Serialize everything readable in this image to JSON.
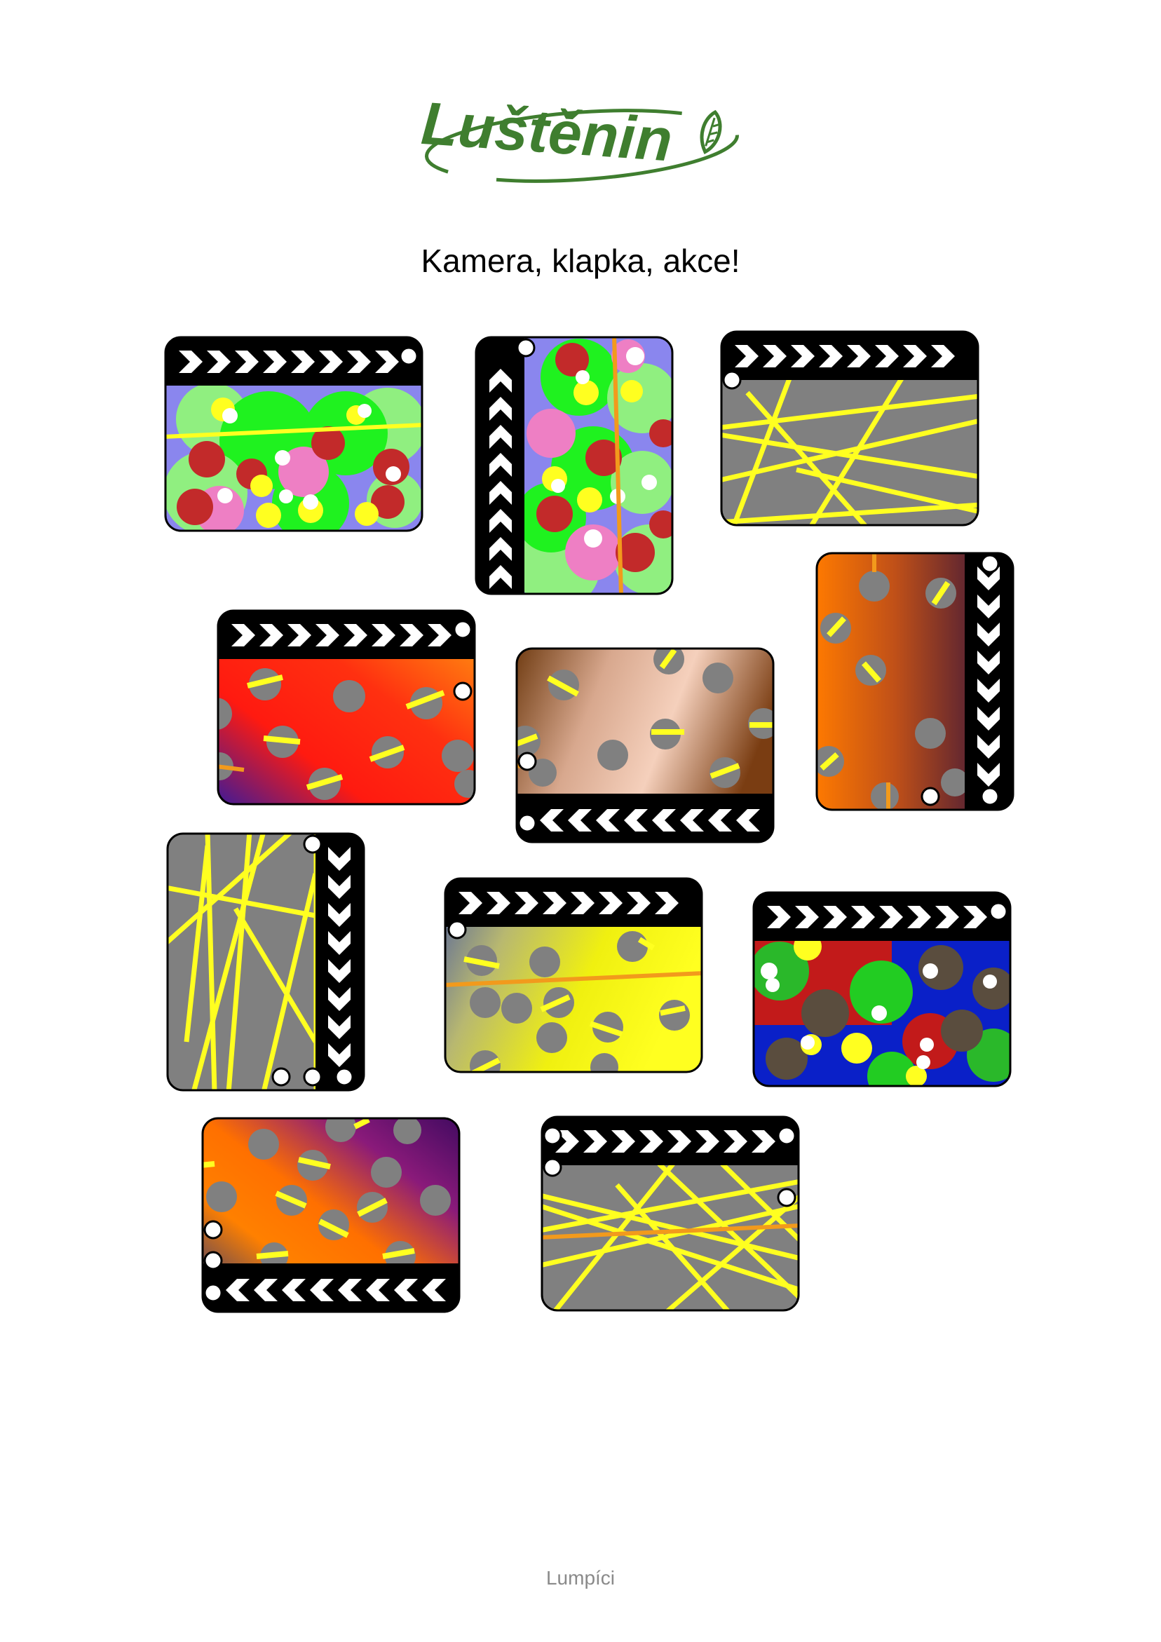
{
  "logo": {
    "text": "Luštěnin",
    "color": "#3f7e2f"
  },
  "title": "Kamera, klapka, akce!",
  "footer": "Lumpíci",
  "cards": [
    {
      "id": "card-1",
      "rotation": 0,
      "pattern": "dots-pastel"
    },
    {
      "id": "card-2",
      "rotation": 90,
      "pattern": "dots-pastel"
    },
    {
      "id": "card-3",
      "rotation": 0,
      "pattern": "lines-gray"
    },
    {
      "id": "card-4",
      "rotation": 0,
      "pattern": "holes-red-orange"
    },
    {
      "id": "card-5",
      "rotation": 180,
      "pattern": "holes-brown-peach"
    },
    {
      "id": "card-6",
      "rotation": 90,
      "pattern": "holes-orange-purple"
    },
    {
      "id": "card-7",
      "rotation": 90,
      "pattern": "lines-gray"
    },
    {
      "id": "card-8",
      "rotation": 0,
      "pattern": "holes-blue-yellow"
    },
    {
      "id": "card-9",
      "rotation": 0,
      "pattern": "dots-primary"
    },
    {
      "id": "card-10",
      "rotation": 180,
      "pattern": "holes-orange-purple-diag"
    },
    {
      "id": "card-11",
      "rotation": 0,
      "pattern": "lines-gray-orange"
    }
  ]
}
